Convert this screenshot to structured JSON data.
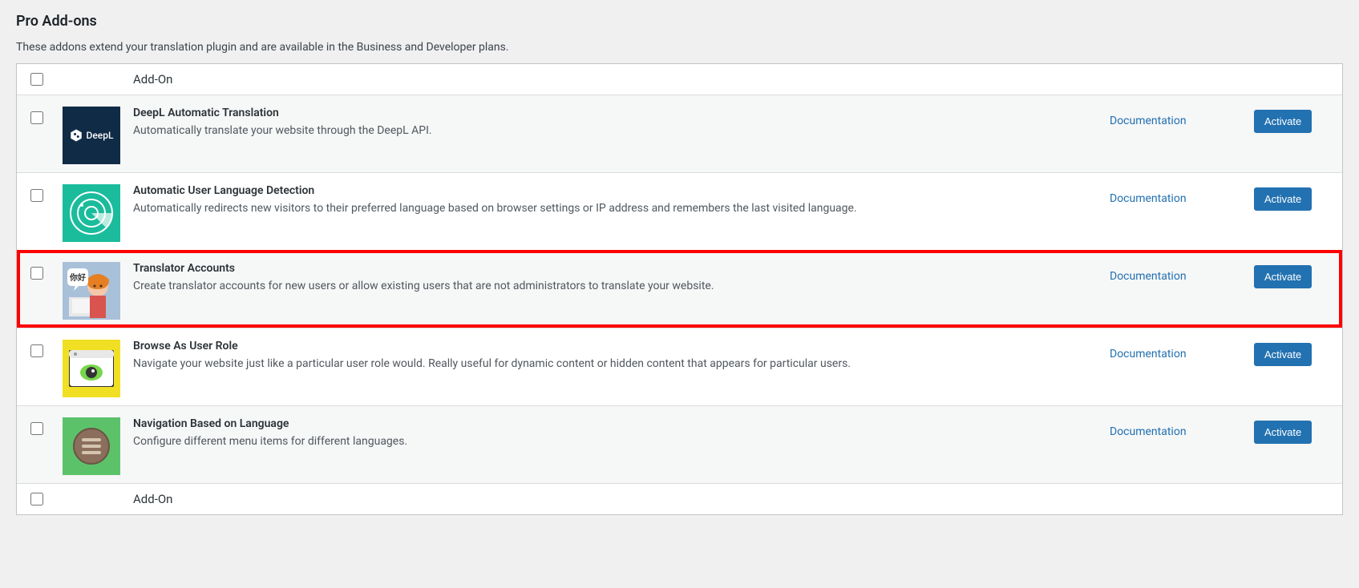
{
  "page": {
    "title": "Pro Add-ons",
    "description": "These addons extend your translation plugin and are available in the Business and Developer plans."
  },
  "table": {
    "header_label": "Add-On",
    "footer_label": "Add-On",
    "documentation_label": "Documentation",
    "activate_label": "Activate"
  },
  "addons": [
    {
      "title": "DeepL Automatic Translation",
      "description": "Automatically translate your website through the DeepL API.",
      "icon": "deepl"
    },
    {
      "title": "Automatic User Language Detection",
      "description": "Automatically redirects new visitors to their preferred language based on browser settings or IP address and remembers the last visited language.",
      "icon": "radar"
    },
    {
      "title": "Translator Accounts",
      "description": "Create translator accounts for new users or allow existing users that are not administrators to translate your website.",
      "icon": "translator",
      "highlighted": true
    },
    {
      "title": "Browse As User Role",
      "description": "Navigate your website just like a particular user role would. Really useful for dynamic content or hidden content that appears for particular users.",
      "icon": "browse"
    },
    {
      "title": "Navigation Based on Language",
      "description": "Configure different menu items for different languages.",
      "icon": "nav"
    }
  ]
}
